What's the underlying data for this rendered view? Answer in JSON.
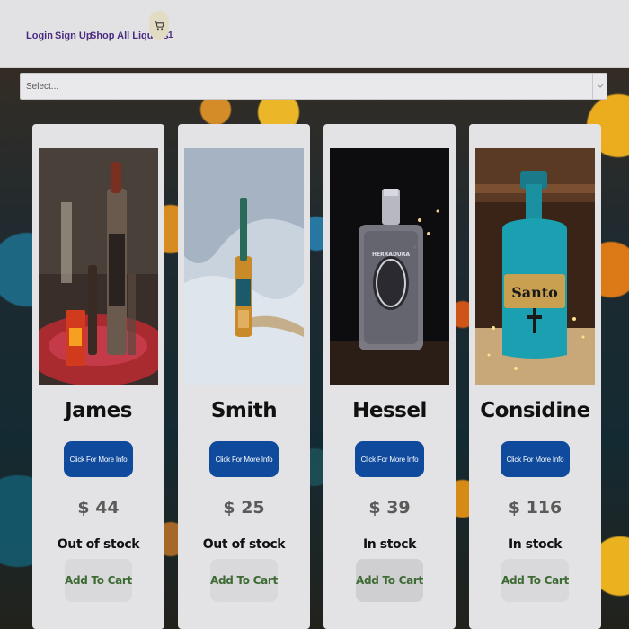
{
  "nav": {
    "login": "Login",
    "signup": "Sign Up",
    "shop_all": "Shop All Liquors",
    "cart_icon": "shopping-cart-icon",
    "cart_count": "1"
  },
  "filter": {
    "placeholder": "Select..."
  },
  "products": [
    {
      "name": "James",
      "info_label": "Click For More Info",
      "price": "$ 44",
      "stock": "Out of stock",
      "add_label": "Add To Cart"
    },
    {
      "name": "Smith",
      "info_label": "Click For More Info",
      "price": "$ 25",
      "stock": "Out of stock",
      "add_label": "Add To Cart"
    },
    {
      "name": "Hessel",
      "info_label": "Click For More Info",
      "price": "$ 39",
      "stock": "In stock",
      "add_label": "Add To Cart"
    },
    {
      "name": "Considine",
      "info_label": "Click For More Info",
      "price": "$ 116",
      "stock": "In stock",
      "add_label": "Add To Cart"
    }
  ],
  "colors": {
    "nav_text": "#4b2b7f",
    "info_button": "#0f4a9c",
    "add_to_cart_text": "#3d6b33",
    "card_background": "#e3e3e5"
  }
}
